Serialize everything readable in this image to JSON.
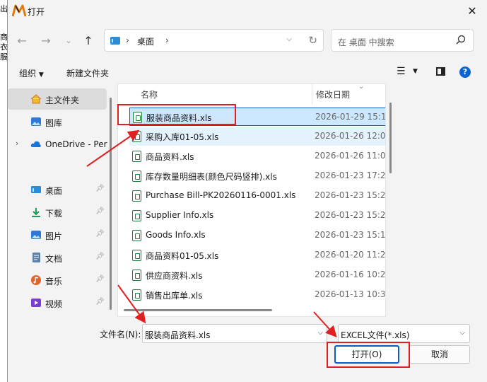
{
  "background_app": {
    "fragments": [
      "出",
      "商",
      "衣",
      "服"
    ]
  },
  "window": {
    "title": "打开",
    "app_logo": "M"
  },
  "address": {
    "location": "桌面",
    "search_placeholder": "在 桌面 中搜索"
  },
  "toolbar": {
    "organize": "组织",
    "new_folder": "新建文件夹"
  },
  "sidebar": {
    "items": [
      {
        "label": "主文件夹",
        "icon": "home-icon",
        "selected": true
      },
      {
        "label": "图库",
        "icon": "gallery-icon"
      },
      {
        "label": "OneDrive - Per",
        "icon": "cloud-icon"
      },
      {
        "label": "桌面",
        "icon": "desktop-icon",
        "pinned": true
      },
      {
        "label": "下载",
        "icon": "download-icon",
        "pinned": true
      },
      {
        "label": "图片",
        "icon": "pictures-icon",
        "pinned": true
      },
      {
        "label": "文档",
        "icon": "documents-icon",
        "pinned": true
      },
      {
        "label": "音乐",
        "icon": "music-icon",
        "pinned": true
      },
      {
        "label": "视频",
        "icon": "videos-icon",
        "pinned": true
      }
    ]
  },
  "filelist": {
    "columns": {
      "name": "名称",
      "date": "修改日期"
    },
    "files": [
      {
        "name": "服装商品资料.xls",
        "date": "2026-01-29 15:1"
      },
      {
        "name": "采购入库01-05.xls",
        "date": "2026-01-26 12:0"
      },
      {
        "name": "商品资料.xls",
        "date": "2026-01-26 11:0"
      },
      {
        "name": "库存数量明细表(颜色尺码竖排).xls",
        "date": "2026-01-23 17:2"
      },
      {
        "name": "Purchase Bill-PK20260116-0001.xls",
        "date": "2026-01-23 15:2"
      },
      {
        "name": "Supplier Info.xls",
        "date": "2026-01-23 15:2"
      },
      {
        "name": "Goods Info.xls",
        "date": "2026-01-23 15:1"
      },
      {
        "name": "商品资料01-05.xls",
        "date": "2026-01-20 11:2"
      },
      {
        "name": "供应商资料.xls",
        "date": "2026-01-16 10:2"
      },
      {
        "name": "销售出库单.xls",
        "date": "2026-01-13 10:3"
      }
    ]
  },
  "bottom": {
    "filename_label": "文件名(N):",
    "filename_value": "服装商品资料.xls",
    "filetype_value": "EXCEL文件(*.xls)",
    "open_button": "打开(O)",
    "cancel_button": "取消"
  },
  "colors": {
    "accent": "#0c5cc5",
    "selection": "#cce8ff",
    "annotation": "#e02020",
    "file_icon": "#1e7d3a"
  }
}
